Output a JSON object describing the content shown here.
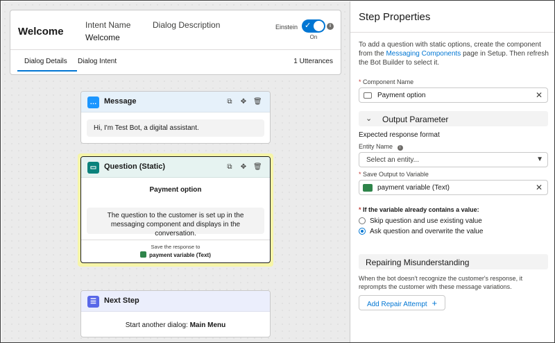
{
  "header": {
    "title": "Welcome",
    "intent_label": "Intent Name",
    "intent_value": "Welcome",
    "description_label": "Dialog Description",
    "einstein_label": "Einstein",
    "toggle_state": "On",
    "info_glyph": "i",
    "tabs": [
      "Dialog Details",
      "Dialog Intent"
    ],
    "utterances": "1 Utterances"
  },
  "canvas": {
    "message_card": {
      "title": "Message",
      "text": "Hi, I'm Test Bot, a digital assistant."
    },
    "question_card": {
      "title": "Question (Static)",
      "component": "Payment option",
      "description": "The question to the customer is set up in the messaging component and displays in the conversation.",
      "save_label": "Save the response to",
      "save_variable": "payment variable (Text)"
    },
    "next_step_card": {
      "title": "Next Step",
      "text_prefix": "Start another dialog:",
      "text_target": "Main Menu"
    }
  },
  "panel": {
    "title": "Step Properties",
    "intro_before": "To add a question with static options, create the component from the",
    "intro_link": "Messaging Components",
    "intro_after": "page in Setup. Then refresh the Bot Builder to select it.",
    "required_mark": "*",
    "component_label": "Component Name",
    "component_value": "Payment option",
    "output_section": "Output Parameter",
    "expected_format": "Expected response format",
    "entity_label": "Entity Name",
    "entity_placeholder": "Select an entity...",
    "save_label": "Save Output to Variable",
    "save_value": "payment variable (Text)",
    "condition_label": "If the variable already contains a value:",
    "options": [
      "Skip question and use existing value",
      "Ask question and overwrite the value"
    ],
    "selected_option": 1,
    "repair_section": "Repairing Misunderstanding",
    "repair_text": "When the bot doesn't recognize the customer's response, it reprompts the customer with these message variations.",
    "repair_button": "Add Repair Attempt"
  },
  "colors": {
    "accent": "#0176d3",
    "message_icon": "#1b96ff",
    "question_icon": "#0b827c",
    "next_step_icon": "#5867e8",
    "variable_icon": "#2e844a",
    "selection_highlight": "#f6f5a8"
  }
}
